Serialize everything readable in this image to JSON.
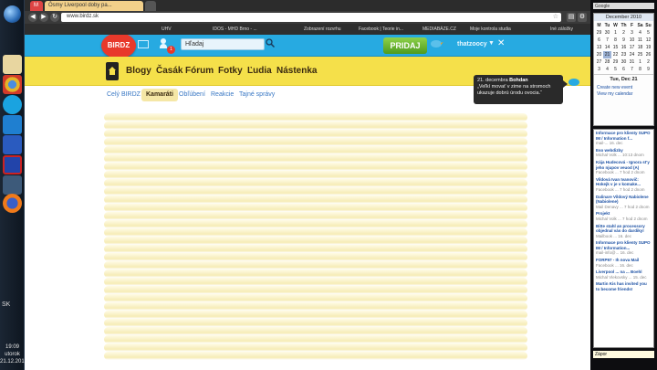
{
  "taskbar": {
    "lang": "SK",
    "clock_time": "19:09",
    "clock_day": "utorok",
    "clock_date": "21.12.2010"
  },
  "browser": {
    "tabs": [
      {
        "label": "M",
        "color": "#d44"
      },
      {
        "label": "Ôsmy Liverpool doby pa...",
        "color": "#f2d08a"
      },
      {
        "label": "",
        "color": "#555"
      }
    ],
    "url": "www.birdz.sk",
    "bookmarks": [
      "UHV",
      "IDOS - MHD Brno - ...",
      "Zobrazení rozvrhu",
      "Facebook | Teorie in...",
      "MEDIABÁZE.CZ",
      "Moje kontrola studia",
      "Iné záložky"
    ]
  },
  "site": {
    "logo": "BIRDZ",
    "notif_count": "1",
    "search_value": "Hľadaj",
    "pridaj": "PRIDAJ",
    "username": "thatzoocy",
    "menu": [
      "Blogy",
      "Časák",
      "Fórum",
      "Fotky",
      "Ľudia",
      "Nástenka"
    ],
    "subnav": {
      "first": "Celý BIRDZ",
      "active": "Kamaráti",
      "rest": [
        "Obľúbení",
        "Reakcie",
        "Tajné správy"
      ]
    },
    "tooltip": {
      "date": "21. decembra",
      "author": "Bohdan",
      "text": "„Veľkí movať v zime na stromoch ukazuje dobrú úrodu ovocia.“"
    }
  },
  "gadgets": {
    "search_placeholder": "Google",
    "calendar": {
      "month": "December 2010",
      "weekdays": [
        "M",
        "Tu",
        "W",
        "Th",
        "F",
        "Sa",
        "Su"
      ],
      "days": [
        "29",
        "30",
        "1",
        "2",
        "3",
        "4",
        "5",
        "6",
        "7",
        "8",
        "9",
        "10",
        "11",
        "12",
        "13",
        "14",
        "15",
        "16",
        "17",
        "18",
        "19",
        "20",
        "21",
        "22",
        "23",
        "24",
        "25",
        "26",
        "27",
        "28",
        "29",
        "30",
        "31",
        "1",
        "2",
        "3",
        "4",
        "5",
        "6",
        "7",
        "8",
        "9"
      ],
      "today_index": 22,
      "today_label": "Tue, Dec 21",
      "links": [
        "Create new event",
        "View my calendar"
      ]
    },
    "feed": [
      {
        "title": "Informace pro klienty SUPO IM / Information f...",
        "meta": "mail-... 16. dec"
      },
      {
        "title": "Eso webdizby",
        "meta": "Michal Volk ... 10:13 dnom"
      },
      {
        "title": "Kája Hudecová - Ignora st'y jeho njupov veuod (A)",
        "meta": "Facebook ... 7 hod 2 dnom"
      },
      {
        "title": "Vildová Ivan Ivanovič: Hokejk v je v komake...",
        "meta": "Facebook ... 7 hod 2 dnom"
      },
      {
        "title": "Dalinare Vildový Nabiolene (Nabiolene)",
        "meta": "Mail Denavy ... 7 hod 2 dnom"
      },
      {
        "title": "Projekt",
        "meta": "Michal Volk ... 7 hod 2 dnom"
      },
      {
        "title": "Bitte stahl an processory objednal vás do dardiky!",
        "meta": "Mailbook ... 16. dec"
      },
      {
        "title": "Informace pro klienty SUPO IM / Information...",
        "meta": "mail-info@... 16. dec"
      },
      {
        "title": "FORP97 - Ih nova Mail",
        "meta": "Facebook ... 16. dec"
      },
      {
        "title": "Liverpool ... na ... Boehl",
        "meta": "Michal Vlekovsky ... 15. dec"
      },
      {
        "title": "Martin Kis has invited you to become friends!",
        "meta": ""
      }
    ],
    "zapor": "Zápor"
  }
}
